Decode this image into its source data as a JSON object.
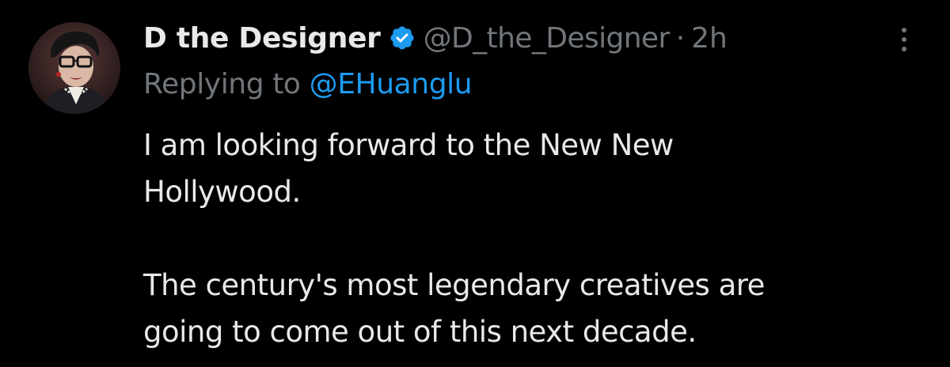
{
  "tweet": {
    "display_name": "D the Designer",
    "handle": "@D_the_Designer",
    "separator": "·",
    "time": "2h",
    "verified": true,
    "reply_prefix": "Replying to",
    "reply_to": "@EHuanglu",
    "text_lines": [
      "I am looking forward to the New New",
      "Hollywood.",
      "The century's most legendary creatives are",
      "going to come out of this next decade."
    ]
  },
  "icons": {
    "verified": "verified-badge-icon",
    "more": "more-vertical-icon"
  },
  "colors": {
    "background": "#000000",
    "primary_text": "#e7e9ea",
    "secondary_text": "#71767b",
    "accent": "#1d9bf0"
  }
}
